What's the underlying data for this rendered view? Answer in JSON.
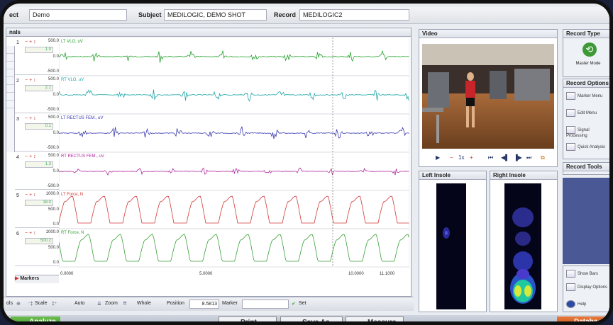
{
  "header": {
    "project_label": "ect",
    "project_value": "Demo",
    "subject_label": "Subject",
    "subject_value": "MEDILOGIC, DEMO SHOT",
    "record_label": "Record",
    "record_value": "MEDILOGIC2"
  },
  "signals_panel": {
    "title": "nals"
  },
  "channels": [
    {
      "num": "1",
      "value": "1.0",
      "name": "LT VLO, uV",
      "scale_top": "500.0",
      "scale_mid": "0.0",
      "scale_bot": "-500.0",
      "color": "#22a02a"
    },
    {
      "num": "2",
      "value": "2.1",
      "name": "RT VLO, uV",
      "scale_top": "500.0",
      "scale_mid": "0.0",
      "scale_bot": "-500.0",
      "color": "#1fa5a5"
    },
    {
      "num": "3",
      "value": "0.1",
      "name": "LT RECTUS FEM., uV",
      "scale_top": "500.0",
      "scale_mid": "0.0",
      "scale_bot": "-500.0",
      "color": "#3a3ab0"
    },
    {
      "num": "4",
      "value": "1.3",
      "name": "RT RECTUS FEM., uV",
      "scale_top": "500.0",
      "scale_mid": "0.0",
      "scale_bot": "-500.0",
      "color": "#b02a9e"
    },
    {
      "num": "5",
      "value": "18.0",
      "name": "LT Force, N",
      "scale_top": "1000.0",
      "scale_mid": "500.0",
      "scale_bot": "0.0",
      "color": "#d23a3a"
    },
    {
      "num": "6",
      "value": "500.2",
      "name": "RT Force, N",
      "scale_top": "1000.0",
      "scale_mid": "500.0",
      "scale_bot": "0.0",
      "color": "#3aa03a"
    }
  ],
  "markers_label": "Markers",
  "time_axis": {
    "start": "0.0000",
    "mid": "5.0000",
    "end": "10.0000",
    "end2": "11.1000"
  },
  "toolbar": {
    "tools": "ols",
    "scale": "Scale",
    "auto": "Auto",
    "zoom": "Zoom",
    "whole": "Whole",
    "position_label": "Position",
    "position_value": "8.5813",
    "marker_label": "Marker",
    "marker_value": "",
    "set": "Set"
  },
  "video": {
    "title": "Video",
    "speed": "1x"
  },
  "insoles": {
    "left": "Left Insole",
    "right": "Right Insole"
  },
  "side": {
    "record_type": "Record Type",
    "master_mode": "Master Mode",
    "record_options": "Record Options",
    "marker_menu": "Marker Menu",
    "edit_menu": "Edit Menu",
    "signal_processing": "Signal Processing",
    "quick_analysis": "Quick Analysis",
    "record_tools": "Record Tools",
    "show_bars": "Show Bars",
    "display_options": "Display Options",
    "help": "Help"
  },
  "buttons": {
    "analyze": "Analyze",
    "print": "Print",
    "save_as": "Save As...",
    "measure": "Measure",
    "database": "Databa"
  },
  "colors": {
    "accent": "#3d8f2d",
    "database": "#c24d12"
  }
}
